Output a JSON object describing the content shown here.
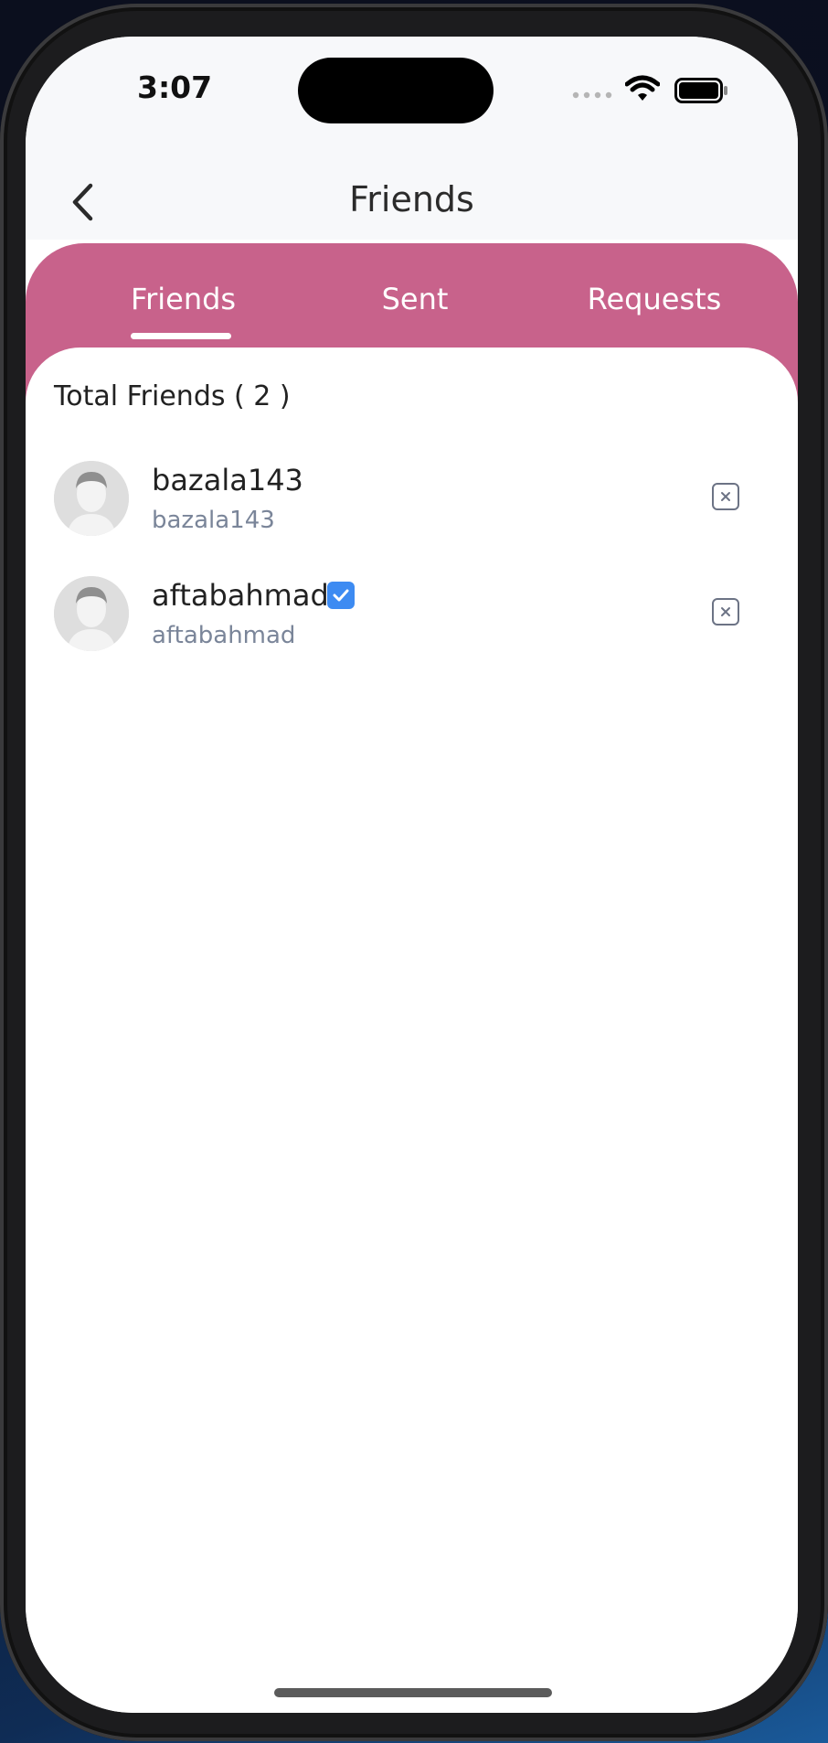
{
  "status_bar": {
    "time": "3:07",
    "signal_icon": "signal-dots-icon",
    "wifi_icon": "wifi-icon",
    "battery_icon": "battery-icon"
  },
  "header": {
    "back_icon": "chevron-left-icon",
    "title": "Friends"
  },
  "tabs": [
    {
      "label": "Friends",
      "active": true
    },
    {
      "label": "Sent",
      "active": false
    },
    {
      "label": "Requests",
      "active": false
    }
  ],
  "total_label": "Total Friends ( 2 )",
  "friends": [
    {
      "name": "bazala143",
      "handle": "bazala143",
      "verified": false,
      "remove_icon": "close-square-icon"
    },
    {
      "name": "aftabahmad",
      "handle": "aftabahmad",
      "verified": true,
      "remove_icon": "close-square-icon"
    }
  ],
  "colors": {
    "accent": "#c8628b",
    "verified": "#3d8bf2",
    "handle_text": "#7a8599"
  }
}
